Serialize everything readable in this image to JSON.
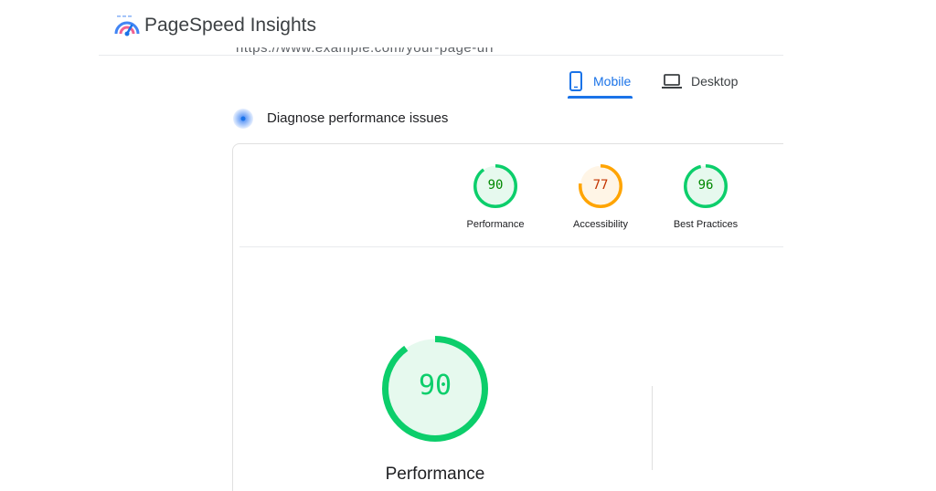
{
  "app": {
    "title": "PageSpeed Insights"
  },
  "url_partial": "https://www.example.com/your-page-url",
  "tabs": [
    {
      "label": "Mobile",
      "icon": "smartphone-icon",
      "selected": true
    },
    {
      "label": "Desktop",
      "icon": "laptop-icon",
      "selected": false
    }
  ],
  "section": {
    "title": "Diagnose performance issues"
  },
  "categories": [
    {
      "label": "Performance",
      "score": "90",
      "fraction": 0.9,
      "color": "#0cce6b",
      "fill": "#e6f9ee",
      "text_color": "#008800"
    },
    {
      "label": "Accessibility",
      "score": "77",
      "fraction": 0.77,
      "color": "#ffa400",
      "fill": "#fff5e6",
      "text_color": "#c33300"
    },
    {
      "label": "Best Practices",
      "score": "96",
      "fraction": 0.96,
      "color": "#0cce6b",
      "fill": "#e6f9ee",
      "text_color": "#008800"
    }
  ],
  "main_gauge": {
    "label": "Performance",
    "score": "90",
    "fraction": 0.9,
    "color": "#0cce6b",
    "fill": "#e6f9ee"
  },
  "colors": {
    "accent": "#1a73e8",
    "pass": "#0cce6b",
    "average": "#ffa400"
  }
}
